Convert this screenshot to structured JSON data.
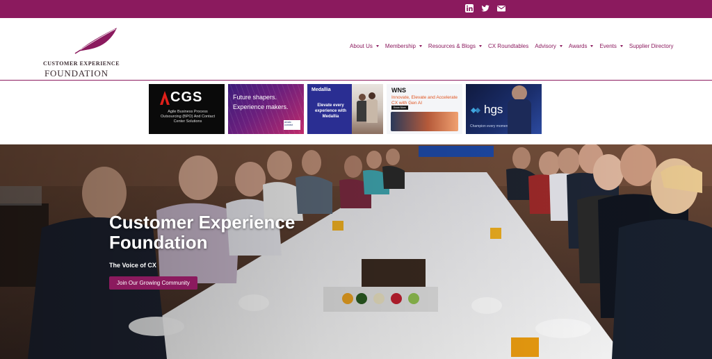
{
  "colors": {
    "brand": "#8b1a5e"
  },
  "social": [
    {
      "icon": "linkedin-icon"
    },
    {
      "icon": "twitter-icon"
    },
    {
      "icon": "email-icon"
    }
  ],
  "logo": {
    "line1": "CUSTOMER EXPERIENCE",
    "line2": "FOUNDATION"
  },
  "nav": {
    "items": [
      {
        "label": "About Us",
        "dropdown": true
      },
      {
        "label": "Membership",
        "dropdown": true
      },
      {
        "label": "Resources & Blogs",
        "dropdown": true
      },
      {
        "label": "CX Roundtables",
        "dropdown": false
      },
      {
        "label": "Advisory",
        "dropdown": true
      },
      {
        "label": "Awards",
        "dropdown": true
      },
      {
        "label": "Events",
        "dropdown": true
      },
      {
        "label": "Supplier Directory",
        "dropdown": false
      }
    ]
  },
  "ads": {
    "cgs": {
      "brand": "CGS",
      "tagline": "Agile Business Process Outsourcing (BPO) And Contact Center Solutions"
    },
    "arvato": {
      "line1": "Future shapers.",
      "line2": "Experience makers.",
      "brand": "arvato connect"
    },
    "medallia": {
      "brand": "Medallia",
      "text": "Elevate every experience with Medallia"
    },
    "wns": {
      "brand": "WNS",
      "text": "Innovate, Elevate and Accelerate CX with Gen AI",
      "cta": "Know More"
    },
    "hgs": {
      "brand": "hgs",
      "tagline": "Champion every moment"
    }
  },
  "hero": {
    "title_line1": "Customer Experience",
    "title_line2": "Foundation",
    "subtitle": "The Voice of CX",
    "button": "Join Our Growing Community"
  }
}
